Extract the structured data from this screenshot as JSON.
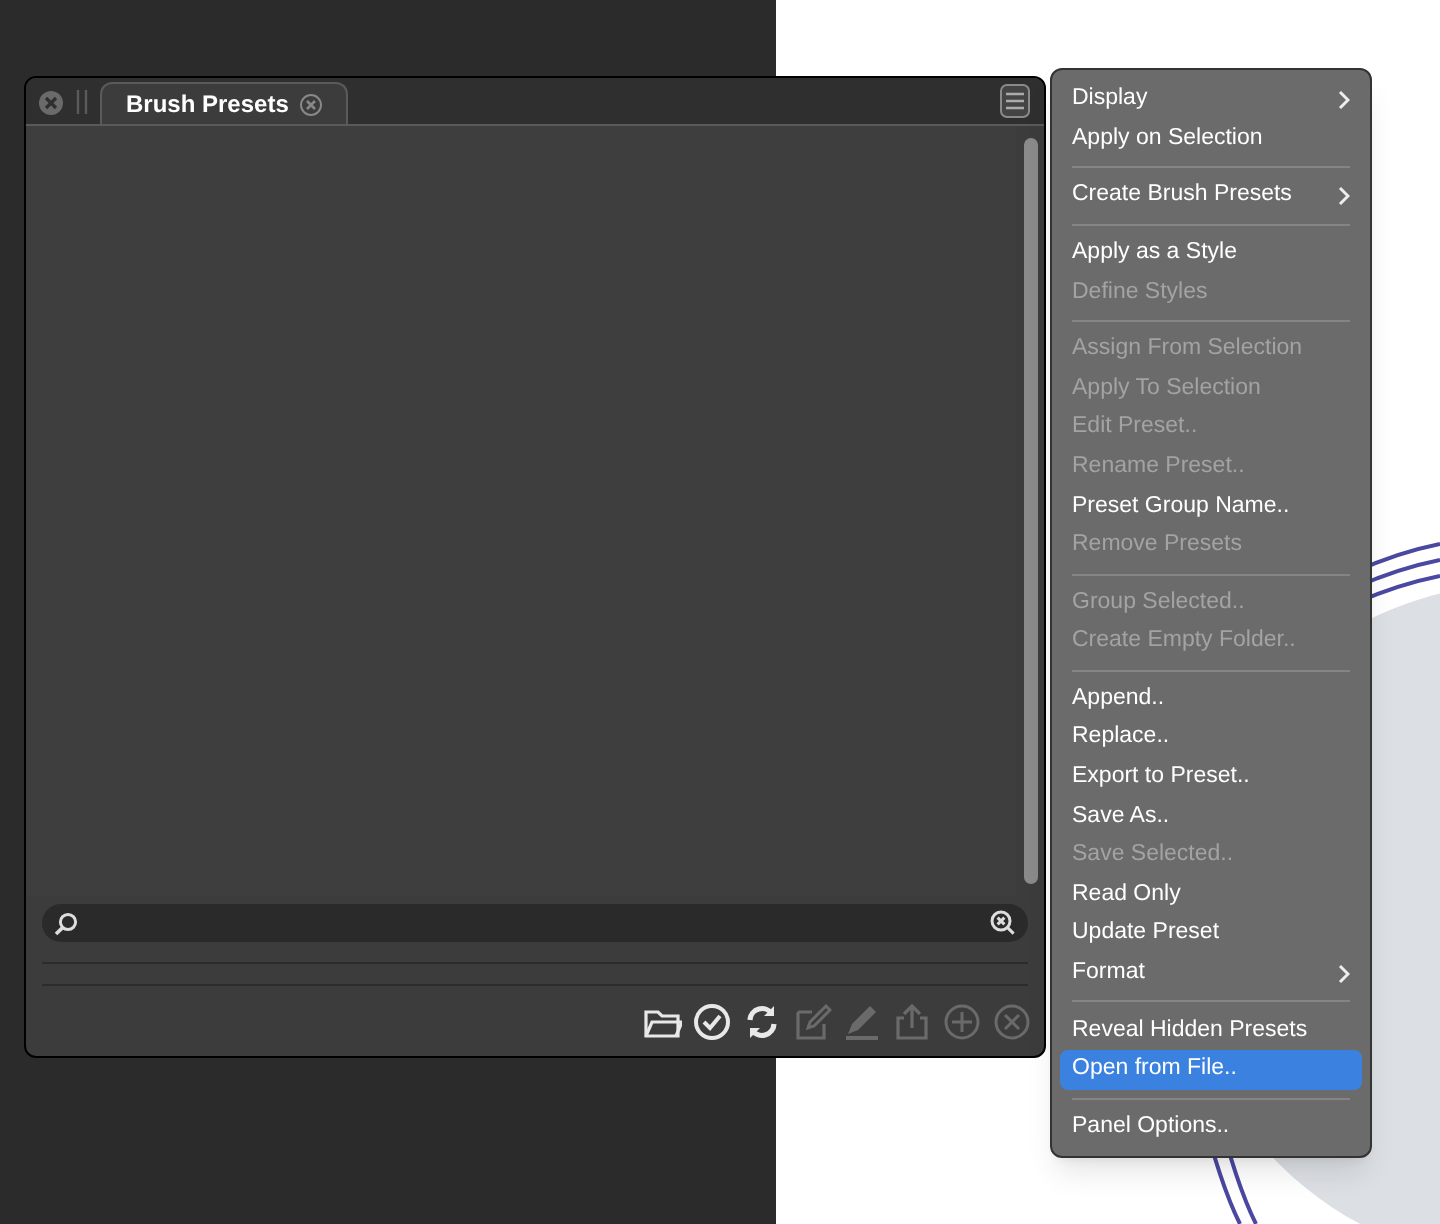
{
  "panel": {
    "tabs": [
      {
        "label": "Brush Presets",
        "selected": true
      }
    ],
    "toolbar": [
      {
        "kind": "folder",
        "disabled": false
      },
      {
        "kind": "check",
        "disabled": false
      },
      {
        "kind": "refresh",
        "disabled": false
      },
      {
        "kind": "edit",
        "disabled": true
      },
      {
        "kind": "pencil",
        "disabled": true
      },
      {
        "kind": "share",
        "disabled": true
      },
      {
        "kind": "add",
        "disabled": true
      },
      {
        "kind": "remove",
        "disabled": true
      }
    ]
  },
  "menu": {
    "groups": [
      [
        {
          "label": "Display",
          "disabled": false,
          "submenu": true,
          "selected": false
        },
        {
          "label": "Apply on Selection",
          "disabled": false,
          "submenu": false,
          "selected": false
        }
      ],
      [
        {
          "label": "Create Brush Presets",
          "disabled": false,
          "submenu": true,
          "selected": false
        }
      ],
      [
        {
          "label": "Apply as a Style",
          "disabled": false,
          "submenu": false,
          "selected": false
        },
        {
          "label": "Define Styles",
          "disabled": true,
          "submenu": false,
          "selected": false
        }
      ],
      [
        {
          "label": "Assign From Selection",
          "disabled": true,
          "submenu": false,
          "selected": false
        },
        {
          "label": "Apply To Selection",
          "disabled": true,
          "submenu": false,
          "selected": false
        },
        {
          "label": "Edit Preset..",
          "disabled": true,
          "submenu": false,
          "selected": false
        },
        {
          "label": "Rename Preset..",
          "disabled": true,
          "submenu": false,
          "selected": false
        },
        {
          "label": "Preset Group Name..",
          "disabled": false,
          "submenu": false,
          "selected": false
        },
        {
          "label": "Remove Presets",
          "disabled": true,
          "submenu": false,
          "selected": false
        }
      ],
      [
        {
          "label": "Group Selected..",
          "disabled": true,
          "submenu": false,
          "selected": false
        },
        {
          "label": "Create Empty Folder..",
          "disabled": true,
          "submenu": false,
          "selected": false
        }
      ],
      [
        {
          "label": "Append..",
          "disabled": false,
          "submenu": false,
          "selected": false
        },
        {
          "label": "Replace..",
          "disabled": false,
          "submenu": false,
          "selected": false
        },
        {
          "label": "Export to Preset..",
          "disabled": false,
          "submenu": false,
          "selected": false
        },
        {
          "label": "Save As..",
          "disabled": false,
          "submenu": false,
          "selected": false
        },
        {
          "label": "Save Selected..",
          "disabled": true,
          "submenu": false,
          "selected": false
        },
        {
          "label": "Read Only",
          "disabled": false,
          "submenu": false,
          "selected": false
        },
        {
          "label": "Update Preset",
          "disabled": false,
          "submenu": false,
          "selected": false
        },
        {
          "label": "Format",
          "disabled": false,
          "submenu": true,
          "selected": false
        }
      ],
      [
        {
          "label": "Reveal Hidden Presets",
          "disabled": false,
          "submenu": false,
          "selected": false
        },
        {
          "label": "Open from File..",
          "disabled": false,
          "submenu": false,
          "selected": true
        }
      ],
      [
        {
          "label": "Panel Options..",
          "disabled": false,
          "submenu": false,
          "selected": false
        }
      ]
    ]
  }
}
